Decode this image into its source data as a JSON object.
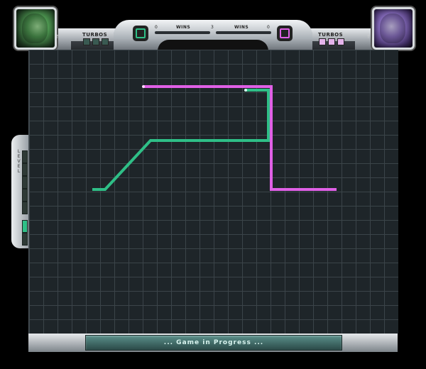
{
  "player1": {
    "turbos_label": "TURBOS",
    "color": "#2fbf87",
    "turbo_count": 3,
    "turbos_used": 0
  },
  "player2": {
    "turbos_label": "TURBOS",
    "color": "#e060e6",
    "turbo_count": 3,
    "turbos_used": 0
  },
  "scoreboard": {
    "wins_label": "WINS",
    "p1_wins": "0",
    "round": "3",
    "p2_wins": "0"
  },
  "level": {
    "label": "LEVEL",
    "segments": 7,
    "active_segment": 6
  },
  "status": {
    "text": "... Game in Progress ..."
  },
  "colors": {
    "p1_trail": "#2fbf87",
    "p2_trail": "#e060e6",
    "grid_bg": "#1e2529",
    "grid_line": "#3b4449"
  },
  "icons": {
    "p1_portrait": "player1-portrait",
    "p2_portrait": "player2-portrait"
  }
}
